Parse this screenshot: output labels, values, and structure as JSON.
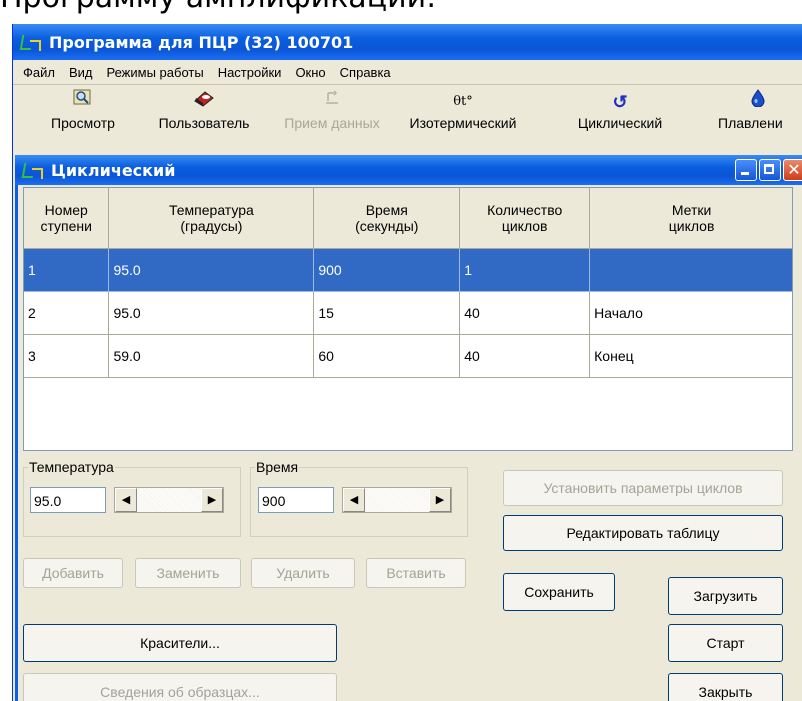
{
  "document": {
    "heading": "Программу амплификации:"
  },
  "app": {
    "title": "Программа для ПЦР (32) 100701",
    "menu": [
      "Файл",
      "Вид",
      "Режимы работы",
      "Настройки",
      "Окно",
      "Справка"
    ],
    "toolbar": [
      {
        "label": "Просмотр",
        "icon": "magnifier-icon",
        "enabled": true
      },
      {
        "label": "Пользователь",
        "icon": "user-icon",
        "enabled": true
      },
      {
        "label": "Прием данных",
        "icon": "data-receive-icon",
        "enabled": false
      },
      {
        "label": "Изотермический",
        "icon": "thermometer-icon",
        "enabled": true
      },
      {
        "label": "Циклический",
        "icon": "cycle-arrow-icon",
        "enabled": true
      },
      {
        "label": "Плавлени",
        "icon": "melt-drop-icon",
        "enabled": true
      }
    ],
    "toolbar_glyphs": {
      "isothermal": "θt°",
      "cyclic": "↺"
    }
  },
  "window": {
    "title": "Циклический",
    "close_glyph": "✕"
  },
  "table": {
    "columns": [
      {
        "line1": "Номер",
        "line2": "ступени"
      },
      {
        "line1": "Температура",
        "line2": "(градусы)"
      },
      {
        "line1": "Время",
        "line2": "(секунды)"
      },
      {
        "line1": "Количество",
        "line2": "циклов"
      },
      {
        "line1": "Метки",
        "line2": "циклов"
      }
    ],
    "rows": [
      {
        "step": "1",
        "temp": "95.0",
        "time": "900",
        "cycles": "1",
        "mark": ""
      },
      {
        "step": "2",
        "temp": "95.0",
        "time": "15",
        "cycles": "40",
        "mark": "Начало"
      },
      {
        "step": "3",
        "temp": "59.0",
        "time": "60",
        "cycles": "40",
        "mark": "Конец"
      }
    ],
    "selected_row": 0
  },
  "controls": {
    "temperature": {
      "label": "Температура",
      "value": "95.0"
    },
    "time": {
      "label": "Время",
      "value": "900"
    },
    "arrow_left": "◀",
    "arrow_right": "▶",
    "buttons": {
      "add": "Добавить",
      "replace": "Заменить",
      "delete": "Удалить",
      "insert": "Вставить",
      "set_cycle_params": "Установить параметры циклов",
      "edit_table": "Редактировать таблицу",
      "save": "Сохранить",
      "load": "Загрузить",
      "dyes": "Красители...",
      "start": "Старт",
      "sample_info": "Сведения об образцах...",
      "close": "Закрыть"
    }
  },
  "colors": {
    "title_bar": "#0a5ee0",
    "selection": "#316ac5",
    "face": "#ece9d8",
    "close_button": "#cf3d18"
  }
}
